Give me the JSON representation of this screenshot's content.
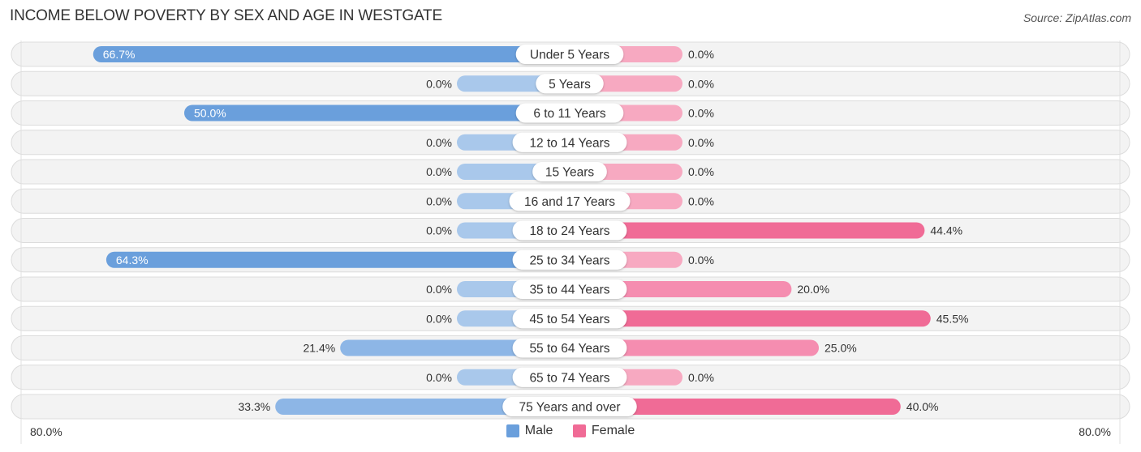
{
  "title": "INCOME BELOW POVERTY BY SEX AND AGE IN WESTGATE",
  "source": "Source: ZipAtlas.com",
  "chart_data": {
    "type": "bar",
    "orientation": "horizontal-diverging",
    "title": "INCOME BELOW POVERTY BY SEX AND AGE IN WESTGATE",
    "categories": [
      "Under 5 Years",
      "5 Years",
      "6 to 11 Years",
      "12 to 14 Years",
      "15 Years",
      "16 and 17 Years",
      "18 to 24 Years",
      "25 to 34 Years",
      "35 to 44 Years",
      "45 to 54 Years",
      "55 to 64 Years",
      "65 to 74 Years",
      "75 Years and over"
    ],
    "series": [
      {
        "name": "Male",
        "color": "#6a9fdc",
        "values": [
          66.7,
          0.0,
          50.0,
          0.0,
          0.0,
          0.0,
          0.0,
          64.3,
          0.0,
          0.0,
          21.4,
          0.0,
          33.3
        ]
      },
      {
        "name": "Female",
        "color": "#f06b96",
        "values": [
          0.0,
          0.0,
          0.0,
          0.0,
          0.0,
          0.0,
          44.4,
          0.0,
          20.0,
          45.5,
          25.0,
          0.0,
          40.0
        ]
      }
    ],
    "xlim": [
      -80,
      80
    ],
    "axis_labels": {
      "left": "80.0%",
      "right": "80.0%"
    },
    "legend": {
      "position": "bottom-center",
      "entries": [
        "Male",
        "Female"
      ]
    }
  },
  "colors": {
    "male_strong": "#6a9fdc",
    "male_light": "#a9c8eb",
    "female_strong": "#f06b96",
    "female_light": "#f7a9c1",
    "row_bg": "#f3f3f3"
  }
}
